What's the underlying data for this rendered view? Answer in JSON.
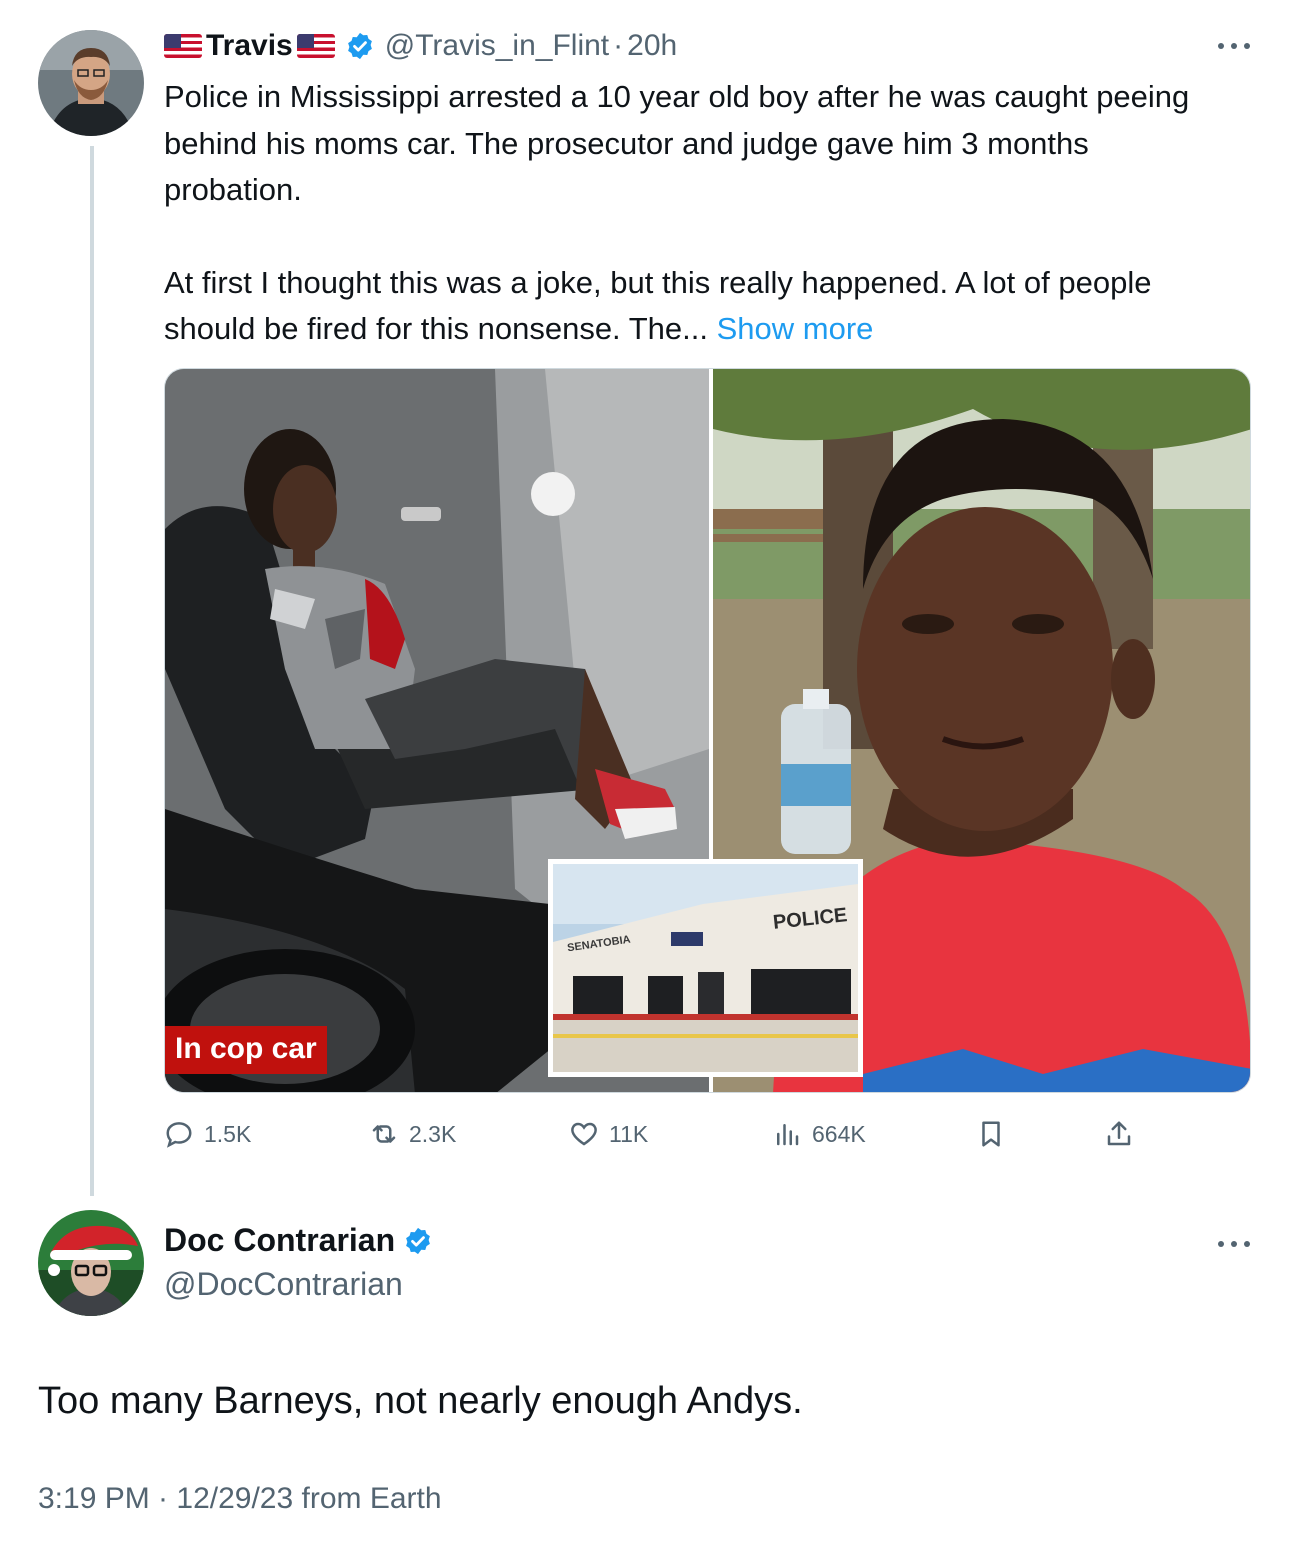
{
  "tweet": {
    "author_name": "Travis",
    "handle": "@Travis_in_Flint",
    "separator": "·",
    "time": "20h",
    "text_p1": "Police in Mississippi arrested a 10 year old boy after he was caught peeing behind his moms car.  The prosecutor and judge gave him 3 months probation.",
    "text_p2": "At first I thought this was a joke, but this really happened.  A lot of people should be fired for this nonsense.  The...",
    "show_more": "Show more",
    "media": {
      "left_caption": "In cop car",
      "inset_building_sign": "POLICE",
      "inset_town_sign": "SENATOBIA"
    },
    "stats": {
      "replies": "1.5K",
      "reposts": "2.3K",
      "likes": "11K",
      "views": "664K"
    }
  },
  "reply": {
    "author_name": "Doc Contrarian",
    "handle": "@DocContrarian",
    "text": "Too many Barneys, not nearly enough Andys.",
    "meta": "3:19 PM · 12/29/23 from Earth"
  },
  "colors": {
    "verified": "#1d9bf0",
    "link": "#1d9bf0",
    "secondary_text": "#536471",
    "caption_red": "#c0110d"
  },
  "icons": [
    "flag-icon",
    "verified-icon",
    "more-icon",
    "reply-icon",
    "repost-icon",
    "like-icon",
    "views-icon",
    "bookmark-icon",
    "share-icon"
  ]
}
